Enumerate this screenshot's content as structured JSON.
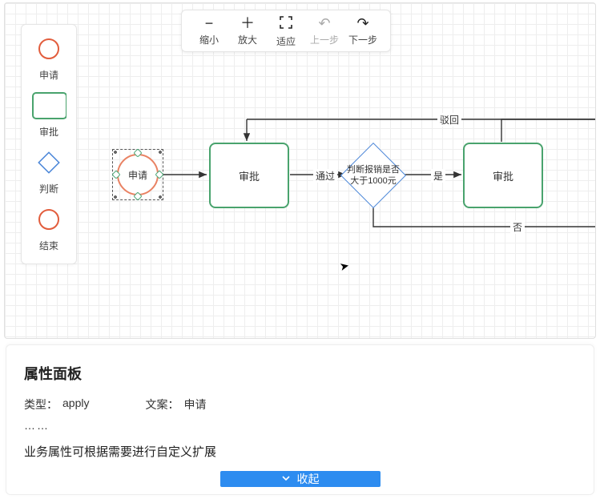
{
  "toolbar": {
    "zoom_out": "缩小",
    "zoom_in": "放大",
    "fit": "适应",
    "undo": "上一步",
    "redo": "下一步"
  },
  "palette": {
    "apply": "申请",
    "approve": "审批",
    "judge": "判断",
    "end": "结束"
  },
  "nodes": {
    "apply": {
      "label": "申请"
    },
    "approve1": {
      "label": "审批"
    },
    "judge": {
      "label": "判断报销是否大于1000元"
    },
    "approve2": {
      "label": "审批"
    }
  },
  "edges": {
    "pass": "通过",
    "yes": "是",
    "no": "否",
    "reject": "驳回"
  },
  "panel": {
    "title": "属性面板",
    "type_label": "类型：",
    "type_value": "apply",
    "text_label": "文案：",
    "text_value": "申请",
    "dots": "……",
    "note": "业务属性可根据需要进行自定义扩展",
    "collapse": "收起"
  },
  "chart_data": {
    "type": "diagram",
    "title": "流程图编辑器 (Flowchart Editor)",
    "nodes": [
      {
        "id": "n1",
        "type": "apply",
        "shape": "circle",
        "label": "申请",
        "selected": true
      },
      {
        "id": "n2",
        "type": "approve",
        "shape": "rectangle",
        "label": "审批"
      },
      {
        "id": "n3",
        "type": "judge",
        "shape": "diamond",
        "label": "判断报销是否大于1000元"
      },
      {
        "id": "n4",
        "type": "approve",
        "shape": "rectangle",
        "label": "审批"
      }
    ],
    "edges": [
      {
        "from": "n1",
        "to": "n2",
        "label": ""
      },
      {
        "from": "n2",
        "to": "n3",
        "label": "通过"
      },
      {
        "from": "n3",
        "to": "n4",
        "label": "是"
      },
      {
        "from": "n3",
        "to": null,
        "label": "否",
        "direction": "down-right"
      },
      {
        "from": "n4",
        "to": null,
        "label": "驳回",
        "direction": "up-right"
      }
    ]
  }
}
